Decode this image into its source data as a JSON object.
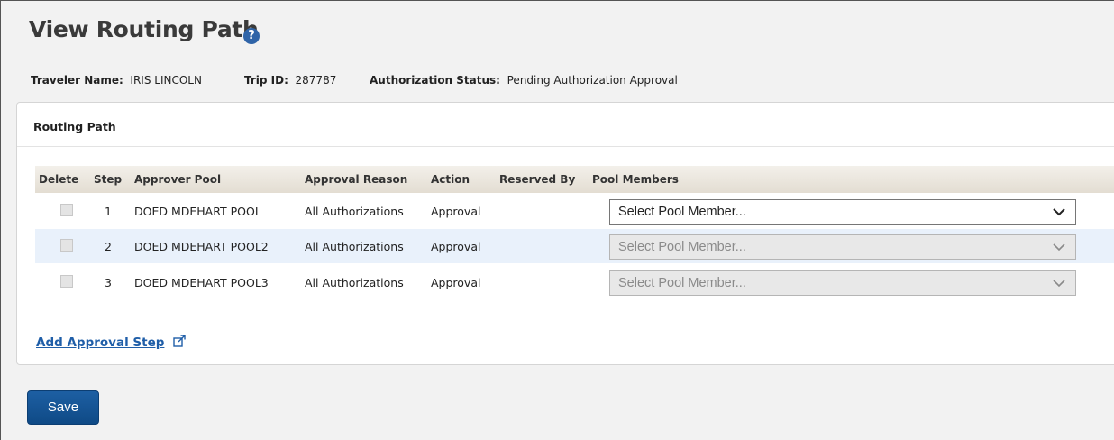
{
  "page": {
    "title": "View Routing Path",
    "help_icon": "question-circle-icon"
  },
  "meta": {
    "traveler_label": "Traveler Name:",
    "traveler_value": "IRIS LINCOLN",
    "trip_label": "Trip ID:",
    "trip_value": "287787",
    "status_label": "Authorization Status:",
    "status_value": "Pending Authorization Approval"
  },
  "panel": {
    "title": "Routing Path"
  },
  "table": {
    "headers": {
      "delete": "Delete",
      "step": "Step",
      "pool": "Approver Pool",
      "reason": "Approval Reason",
      "action": "Action",
      "reserved": "Reserved By",
      "members": "Pool Members"
    },
    "rows": [
      {
        "step": "1",
        "pool": "DOED MDEHART POOL",
        "reason": "All Authorizations",
        "action": "Approval",
        "reserved": "",
        "member": "Select Pool Member...",
        "enabled": true
      },
      {
        "step": "2",
        "pool": "DOED MDEHART POOL2",
        "reason": "All Authorizations",
        "action": "Approval",
        "reserved": "",
        "member": "Select Pool Member...",
        "enabled": false
      },
      {
        "step": "3",
        "pool": "DOED MDEHART POOL3",
        "reason": "All Authorizations",
        "action": "Approval",
        "reserved": "",
        "member": "Select Pool Member...",
        "enabled": false
      }
    ]
  },
  "add_step": {
    "label": "Add Approval Step",
    "icon": "external-link-icon"
  },
  "save": {
    "label": "Save"
  },
  "colors": {
    "accent": "#1f5ea8",
    "button": "#1d5fa3",
    "alt_row": "#e9f1fb"
  }
}
